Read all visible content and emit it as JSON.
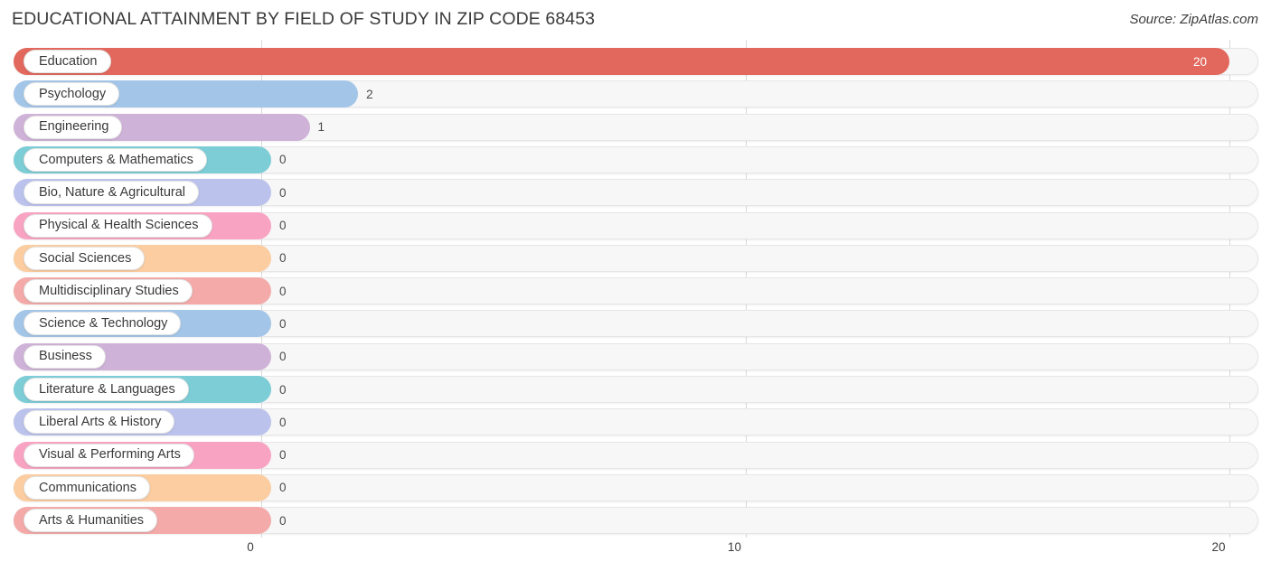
{
  "header": {
    "title": "EDUCATIONAL ATTAINMENT BY FIELD OF STUDY IN ZIP CODE 68453",
    "source": "Source: ZipAtlas.com"
  },
  "chart_data": {
    "type": "bar",
    "orientation": "horizontal",
    "title": "EDUCATIONAL ATTAINMENT BY FIELD OF STUDY IN ZIP CODE 68453",
    "subtitle": "",
    "xlabel": "",
    "ylabel": "",
    "xlim": [
      0,
      20
    ],
    "grid": true,
    "legend": false,
    "tick_labels": [
      "0",
      "10",
      "20"
    ],
    "tick_values": [
      0,
      10,
      20
    ],
    "categories": [
      "Education",
      "Psychology",
      "Engineering",
      "Computers & Mathematics",
      "Bio, Nature & Agricultural",
      "Physical & Health Sciences",
      "Social Sciences",
      "Multidisciplinary Studies",
      "Science & Technology",
      "Business",
      "Literature & Languages",
      "Liberal Arts & History",
      "Visual & Performing Arts",
      "Communications",
      "Arts & Humanities"
    ],
    "values": [
      20,
      2,
      1,
      0,
      0,
      0,
      0,
      0,
      0,
      0,
      0,
      0,
      0,
      0,
      0
    ],
    "value_labels": [
      "20",
      "2",
      "1",
      "0",
      "0",
      "0",
      "0",
      "0",
      "0",
      "0",
      "0",
      "0",
      "0",
      "0",
      "0"
    ],
    "colors": [
      "#e2685e",
      "#a3c6e8",
      "#cfb2d8",
      "#7ccdd6",
      "#bbc2ec",
      "#f9a3c2",
      "#fbcda0",
      "#f3aaa9",
      "#a3c6e8",
      "#cfb2d8",
      "#7ccdd6",
      "#bbc2ec",
      "#f9a3c2",
      "#fbcda0",
      "#f3aaa9"
    ]
  },
  "style": {
    "track_color": "#f7f7f7",
    "grid_color": "#d9d9d9",
    "text_color": "#3a3a3a"
  }
}
